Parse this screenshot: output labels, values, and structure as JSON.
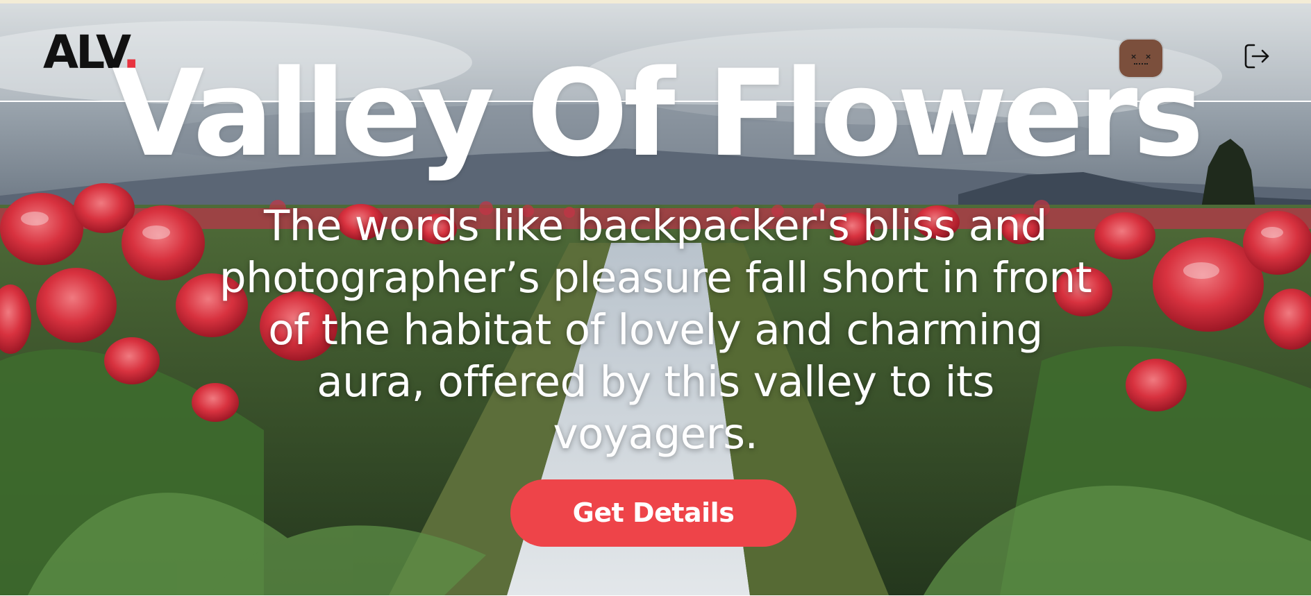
{
  "brand": {
    "logo_text": "ALV",
    "logo_dot": ".",
    "accent_color": "#e8333f"
  },
  "header": {
    "avatar_icon": "robot-avatar-icon",
    "avatar_eyes": "×",
    "logout_icon": "logout-icon"
  },
  "hero": {
    "title": "Valley Of Flowers",
    "subtitle": "The words like backpacker's bliss and photographer’s pleasure fall short in front of the habitat of lovely and charming aura, offered by this valley to its voyagers.",
    "cta_label": "Get Details",
    "cta_color": "#ee4449"
  }
}
